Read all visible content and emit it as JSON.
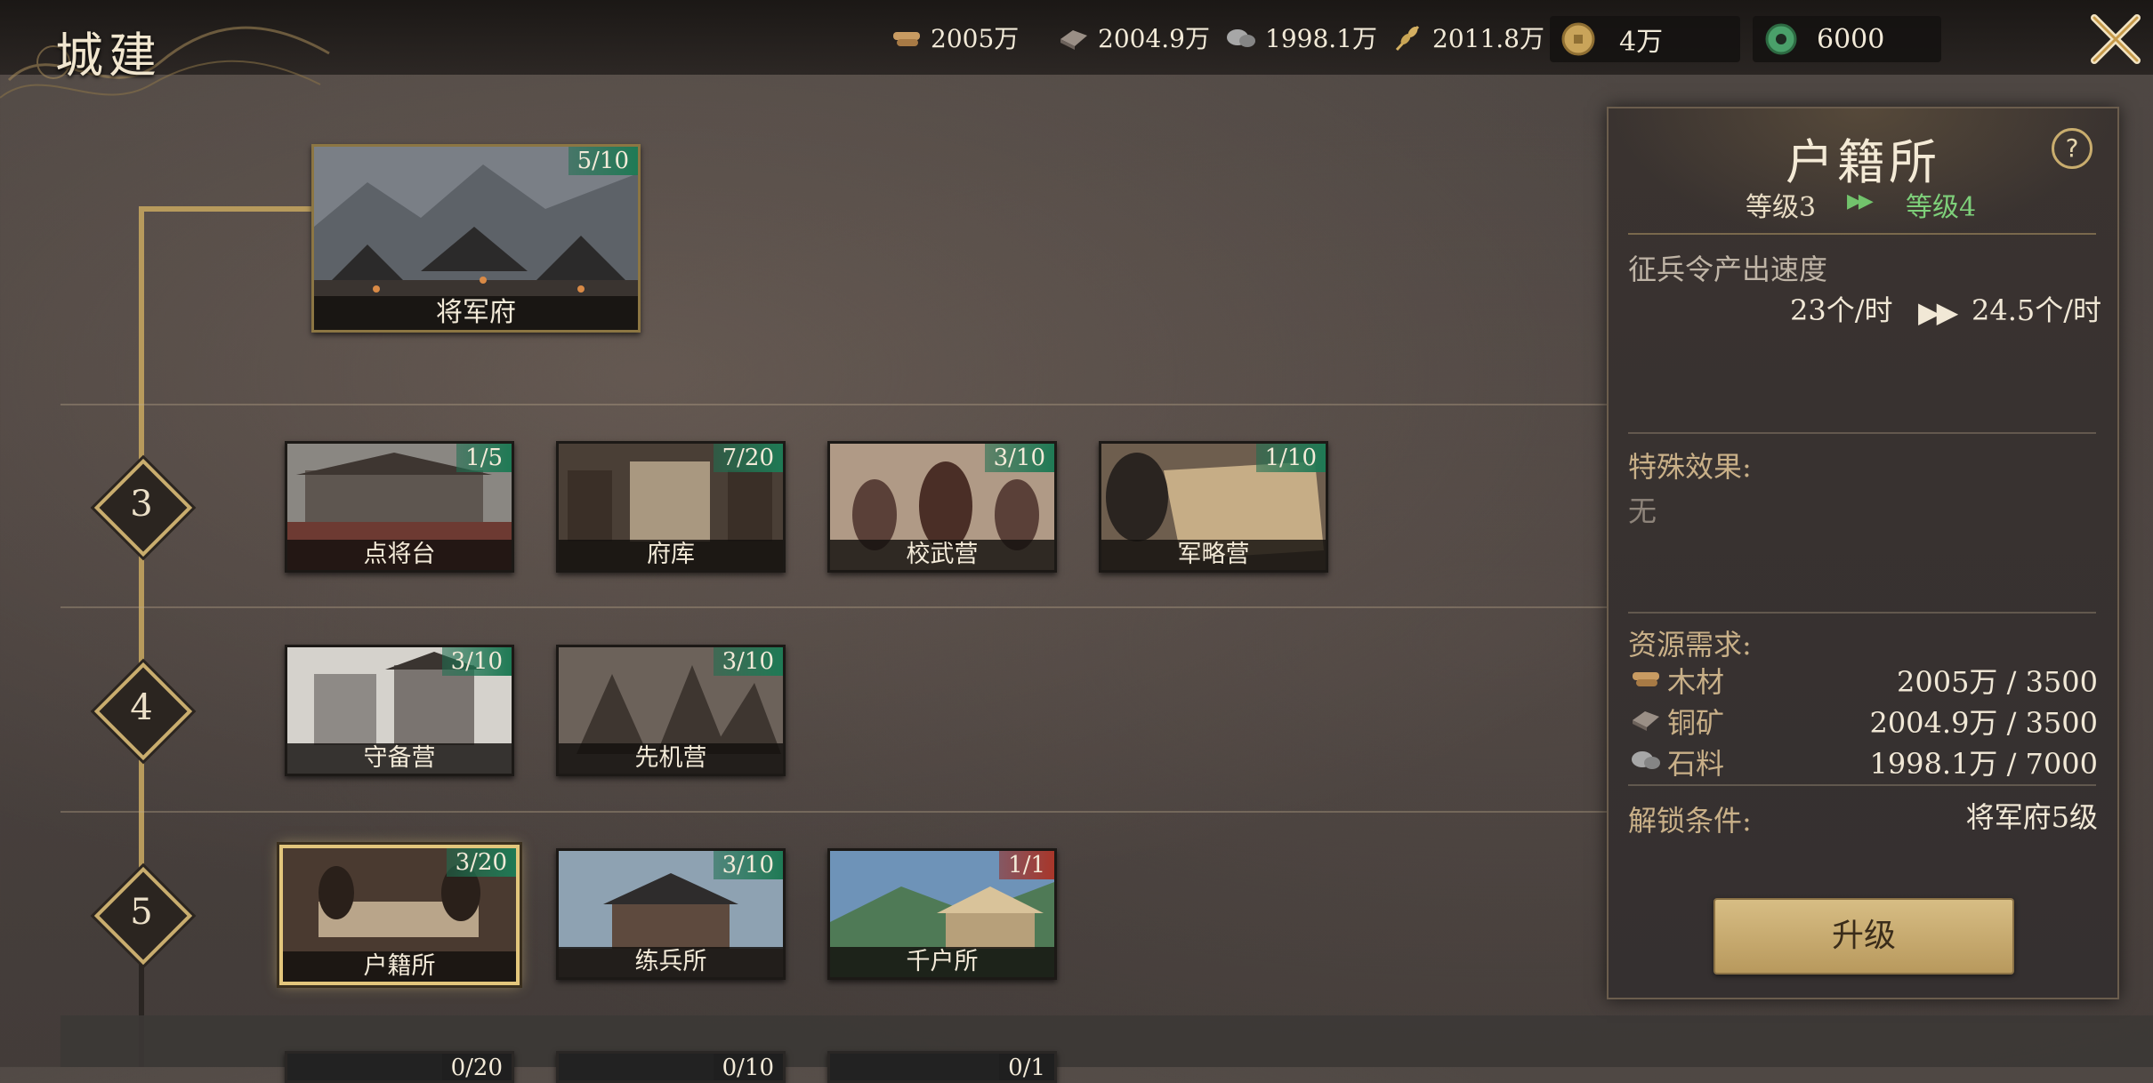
{
  "header": {
    "title": "城建",
    "resources": [
      {
        "icon": "wood-icon",
        "value": "2005万"
      },
      {
        "icon": "copper-icon",
        "value": "2004.9万"
      },
      {
        "icon": "stone-icon",
        "value": "1998.1万"
      },
      {
        "icon": "grain-icon",
        "value": "2011.8万"
      }
    ],
    "gold": {
      "icon": "gold-coin-icon",
      "value": "4万"
    },
    "jade": {
      "icon": "jade-icon",
      "value": "6000"
    }
  },
  "tree": {
    "root": {
      "name": "将军府",
      "level": "5/10"
    },
    "tiers": [
      {
        "number": "3",
        "buildings": [
          {
            "name": "点将台",
            "level": "1/5"
          },
          {
            "name": "府库",
            "level": "7/20"
          },
          {
            "name": "校武营",
            "level": "3/10"
          },
          {
            "name": "军略营",
            "level": "1/10"
          }
        ]
      },
      {
        "number": "4",
        "buildings": [
          {
            "name": "守备营",
            "level": "3/10"
          },
          {
            "name": "先机营",
            "level": "3/10"
          }
        ]
      },
      {
        "number": "5",
        "buildings": [
          {
            "name": "户籍所",
            "level": "3/20"
          },
          {
            "name": "练兵所",
            "level": "3/10"
          },
          {
            "name": "千户所",
            "level": "1/1"
          }
        ]
      }
    ],
    "partial_row_levels": [
      "0/20",
      "0/10",
      "0/1"
    ]
  },
  "panel": {
    "title": "户籍所",
    "help": "?",
    "level_from": "等级3",
    "level_to": "等级4",
    "stat_label": "征兵令产出速度",
    "stat_from": "23个/时",
    "stat_to": "24.5个/时",
    "special_label": "特殊效果:",
    "special_value": "无",
    "req_label": "资源需求:",
    "requirements": [
      {
        "icon": "wood-icon",
        "name": "木材",
        "value": "2005万 / 3500"
      },
      {
        "icon": "copper-icon",
        "name": "铜矿",
        "value": "2004.9万 / 3500"
      },
      {
        "icon": "stone-icon",
        "name": "石料",
        "value": "1998.1万 / 7000"
      }
    ],
    "unlock_label": "解锁条件:",
    "unlock_value": "将军府5级",
    "upgrade_button": "升级"
  },
  "colors": {
    "accent_gold": "#c9ad6e",
    "level_green": "#1f7a55",
    "level_max_red": "#a8362a",
    "upgrade_green": "#7ed07a"
  }
}
